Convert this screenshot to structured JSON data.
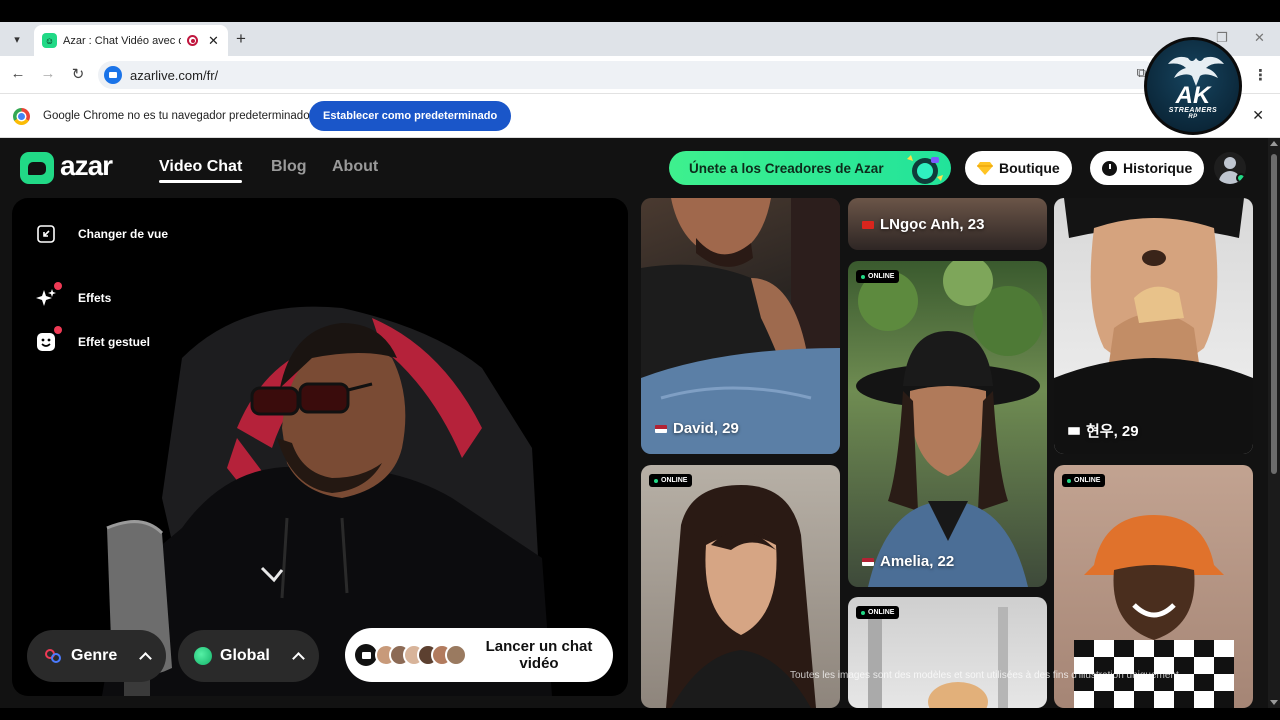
{
  "browser": {
    "tab_title": "Azar : Chat Vidéo avec de n",
    "url": "azarlive.com/fr/"
  },
  "infobar": {
    "message": "Google Chrome no es tu navegador predeterminado",
    "button_label": "Establecer como predeterminado"
  },
  "header": {
    "logo_text": "azar",
    "nav": [
      "Video Chat",
      "Blog",
      "About"
    ],
    "creator_cta": "Únete a los Creadores de Azar",
    "boutique_label": "Boutique",
    "historique_label": "Historique"
  },
  "video_panel": {
    "options": [
      "Changer de vue",
      "Effets",
      "Effet gestuel"
    ],
    "gender_label": "Genre",
    "region_label": "Global",
    "start_label": "Lancer un chat vidéo"
  },
  "gallery": {
    "online_label": "ONLINE",
    "cards": [
      {
        "name": "David, 29",
        "flag": "us",
        "online": false
      },
      {
        "name": "LNgọc Anh, 23",
        "flag": "vn",
        "online": false
      },
      {
        "name": "현우, 29",
        "flag": "kr",
        "online": false
      },
      {
        "name": "Amelia, 22",
        "flag": "us",
        "online": true
      },
      {
        "name": "",
        "flag": "",
        "online": true
      },
      {
        "name": "",
        "flag": "",
        "online": true
      },
      {
        "name": "",
        "flag": "",
        "online": true
      }
    ],
    "disclaimer": "Toutes les images sont des modèles et sont utilisées à des fins d'illustration uniquement."
  },
  "watermark": {
    "big": "AK",
    "small": "STREAMERS",
    "tiny": "RP"
  },
  "colors": {
    "brand_green": "#21d986",
    "background": "#121212",
    "infobar_button": "#1a56c9",
    "notification_red": "#ef3a55"
  }
}
